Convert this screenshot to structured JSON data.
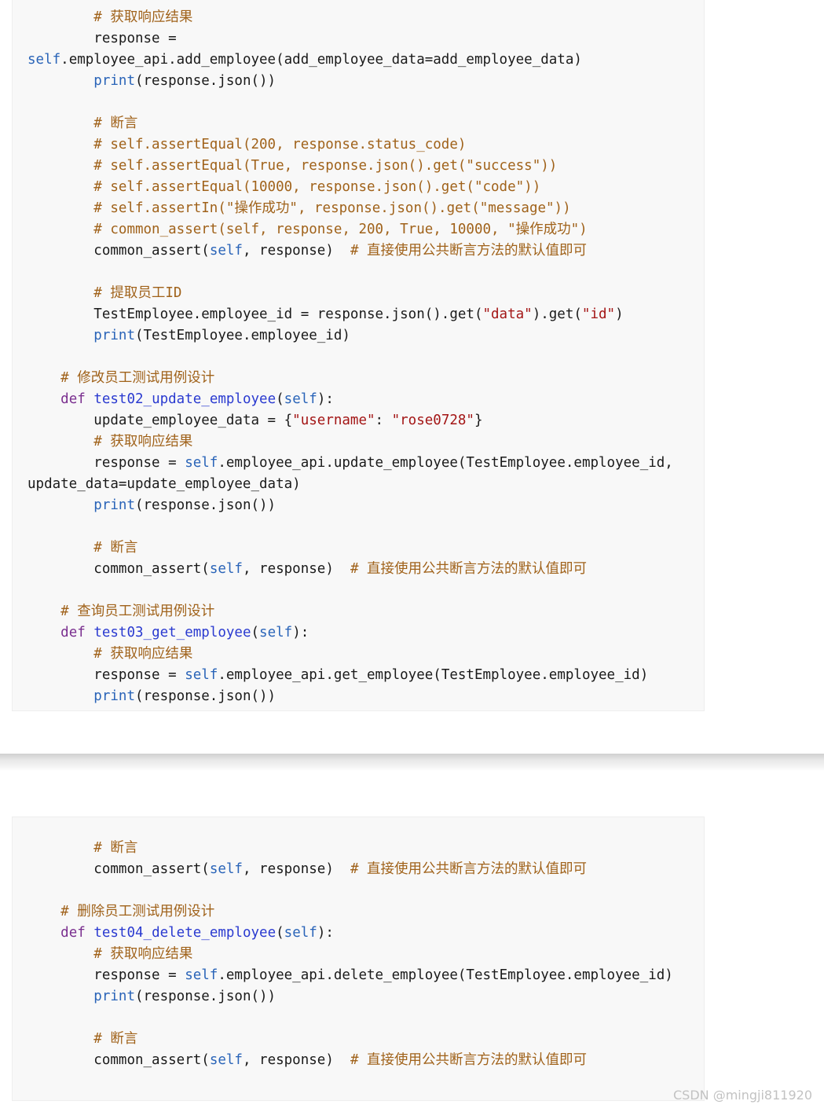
{
  "colors": {
    "comment": "#a0621a",
    "keyword": "#7a2f8f",
    "builtin": "#2a64b8",
    "def_name": "#2a3ad0",
    "string": "#a31515",
    "code_background": "#f8f8f8"
  },
  "code_blocks": [
    {
      "lines": [
        {
          "indent": 8,
          "tokens": [
            {
              "t": "c",
              "v": "# 获取响应结果"
            }
          ]
        },
        {
          "indent": 8,
          "tokens": [
            {
              "t": "p",
              "v": "response ="
            }
          ]
        },
        {
          "indent": 0,
          "tokens": [
            {
              "t": "b",
              "v": "self"
            },
            {
              "t": "p",
              "v": ".employee_api.add_employee(add_employee_data=add_employee_data)"
            }
          ]
        },
        {
          "indent": 8,
          "tokens": [
            {
              "t": "b",
              "v": "print"
            },
            {
              "t": "p",
              "v": "(response.json())"
            }
          ]
        },
        {
          "indent": 0,
          "tokens": []
        },
        {
          "indent": 8,
          "tokens": [
            {
              "t": "c",
              "v": "# 断言"
            }
          ]
        },
        {
          "indent": 8,
          "tokens": [
            {
              "t": "c",
              "v": "# self.assertEqual(200, response.status_code)"
            }
          ]
        },
        {
          "indent": 8,
          "tokens": [
            {
              "t": "c",
              "v": "# self.assertEqual(True, response.json().get(\"success\"))"
            }
          ]
        },
        {
          "indent": 8,
          "tokens": [
            {
              "t": "c",
              "v": "# self.assertEqual(10000, response.json().get(\"code\"))"
            }
          ]
        },
        {
          "indent": 8,
          "tokens": [
            {
              "t": "c",
              "v": "# self.assertIn(\"操作成功\", response.json().get(\"message\"))"
            }
          ]
        },
        {
          "indent": 8,
          "tokens": [
            {
              "t": "c",
              "v": "# common_assert(self, response, 200, True, 10000, \"操作成功\")"
            }
          ]
        },
        {
          "indent": 8,
          "tokens": [
            {
              "t": "p",
              "v": "common_assert("
            },
            {
              "t": "b",
              "v": "self"
            },
            {
              "t": "p",
              "v": ", response)  "
            },
            {
              "t": "c",
              "v": "# 直接使用公共断言方法的默认值即可"
            }
          ]
        },
        {
          "indent": 0,
          "tokens": []
        },
        {
          "indent": 8,
          "tokens": [
            {
              "t": "c",
              "v": "# 提取员工ID"
            }
          ]
        },
        {
          "indent": 8,
          "tokens": [
            {
              "t": "p",
              "v": "TestEmployee.employee_id = response.json().get("
            },
            {
              "t": "s",
              "v": "\"data\""
            },
            {
              "t": "p",
              "v": ").get("
            },
            {
              "t": "s",
              "v": "\"id\""
            },
            {
              "t": "p",
              "v": ")"
            }
          ]
        },
        {
          "indent": 8,
          "tokens": [
            {
              "t": "b",
              "v": "print"
            },
            {
              "t": "p",
              "v": "(TestEmployee.employee_id)"
            }
          ]
        },
        {
          "indent": 0,
          "tokens": []
        },
        {
          "indent": 4,
          "tokens": [
            {
              "t": "c",
              "v": "# 修改员工测试用例设计"
            }
          ]
        },
        {
          "indent": 4,
          "tokens": [
            {
              "t": "k",
              "v": "def "
            },
            {
              "t": "d",
              "v": "test02_update_employee"
            },
            {
              "t": "p",
              "v": "("
            },
            {
              "t": "b",
              "v": "self"
            },
            {
              "t": "p",
              "v": "):"
            }
          ]
        },
        {
          "indent": 8,
          "tokens": [
            {
              "t": "p",
              "v": "update_employee_data = {"
            },
            {
              "t": "s",
              "v": "\"username\""
            },
            {
              "t": "p",
              "v": ": "
            },
            {
              "t": "s",
              "v": "\"rose0728\""
            },
            {
              "t": "p",
              "v": "}"
            }
          ]
        },
        {
          "indent": 8,
          "tokens": [
            {
              "t": "c",
              "v": "# 获取响应结果"
            }
          ]
        },
        {
          "indent": 8,
          "tokens": [
            {
              "t": "p",
              "v": "response = "
            },
            {
              "t": "b",
              "v": "self"
            },
            {
              "t": "p",
              "v": ".employee_api.update_employee(TestEmployee.employee_id,"
            }
          ]
        },
        {
          "indent": 0,
          "tokens": [
            {
              "t": "p",
              "v": "update_data=update_employee_data)"
            }
          ]
        },
        {
          "indent": 8,
          "tokens": [
            {
              "t": "b",
              "v": "print"
            },
            {
              "t": "p",
              "v": "(response.json())"
            }
          ]
        },
        {
          "indent": 0,
          "tokens": []
        },
        {
          "indent": 8,
          "tokens": [
            {
              "t": "c",
              "v": "# 断言"
            }
          ]
        },
        {
          "indent": 8,
          "tokens": [
            {
              "t": "p",
              "v": "common_assert("
            },
            {
              "t": "b",
              "v": "self"
            },
            {
              "t": "p",
              "v": ", response)  "
            },
            {
              "t": "c",
              "v": "# 直接使用公共断言方法的默认值即可"
            }
          ]
        },
        {
          "indent": 0,
          "tokens": []
        },
        {
          "indent": 4,
          "tokens": [
            {
              "t": "c",
              "v": "# 查询员工测试用例设计"
            }
          ]
        },
        {
          "indent": 4,
          "tokens": [
            {
              "t": "k",
              "v": "def "
            },
            {
              "t": "d",
              "v": "test03_get_employee"
            },
            {
              "t": "p",
              "v": "("
            },
            {
              "t": "b",
              "v": "self"
            },
            {
              "t": "p",
              "v": "):"
            }
          ]
        },
        {
          "indent": 8,
          "tokens": [
            {
              "t": "c",
              "v": "# 获取响应结果"
            }
          ]
        },
        {
          "indent": 8,
          "tokens": [
            {
              "t": "p",
              "v": "response = "
            },
            {
              "t": "b",
              "v": "self"
            },
            {
              "t": "p",
              "v": ".employee_api.get_employee(TestEmployee.employee_id)"
            }
          ]
        },
        {
          "indent": 8,
          "tokens": [
            {
              "t": "b",
              "v": "print"
            },
            {
              "t": "p",
              "v": "(response.json())"
            }
          ]
        }
      ]
    },
    {
      "lines": [
        {
          "indent": 8,
          "tokens": [
            {
              "t": "c",
              "v": "# 断言"
            }
          ]
        },
        {
          "indent": 8,
          "tokens": [
            {
              "t": "p",
              "v": "common_assert("
            },
            {
              "t": "b",
              "v": "self"
            },
            {
              "t": "p",
              "v": ", response)  "
            },
            {
              "t": "c",
              "v": "# 直接使用公共断言方法的默认值即可"
            }
          ]
        },
        {
          "indent": 0,
          "tokens": []
        },
        {
          "indent": 4,
          "tokens": [
            {
              "t": "c",
              "v": "# 删除员工测试用例设计"
            }
          ]
        },
        {
          "indent": 4,
          "tokens": [
            {
              "t": "k",
              "v": "def "
            },
            {
              "t": "d",
              "v": "test04_delete_employee"
            },
            {
              "t": "p",
              "v": "("
            },
            {
              "t": "b",
              "v": "self"
            },
            {
              "t": "p",
              "v": "):"
            }
          ]
        },
        {
          "indent": 8,
          "tokens": [
            {
              "t": "c",
              "v": "# 获取响应结果"
            }
          ]
        },
        {
          "indent": 8,
          "tokens": [
            {
              "t": "p",
              "v": "response = "
            },
            {
              "t": "b",
              "v": "self"
            },
            {
              "t": "p",
              "v": ".employee_api.delete_employee(TestEmployee.employee_id)"
            }
          ]
        },
        {
          "indent": 8,
          "tokens": [
            {
              "t": "b",
              "v": "print"
            },
            {
              "t": "p",
              "v": "(response.json())"
            }
          ]
        },
        {
          "indent": 0,
          "tokens": []
        },
        {
          "indent": 8,
          "tokens": [
            {
              "t": "c",
              "v": "# 断言"
            }
          ]
        },
        {
          "indent": 8,
          "tokens": [
            {
              "t": "p",
              "v": "common_assert("
            },
            {
              "t": "b",
              "v": "self"
            },
            {
              "t": "p",
              "v": ", response)  "
            },
            {
              "t": "c",
              "v": "# 直接使用公共断言方法的默认值即可"
            }
          ]
        }
      ]
    }
  ],
  "watermark": "CSDN @mingji811920"
}
